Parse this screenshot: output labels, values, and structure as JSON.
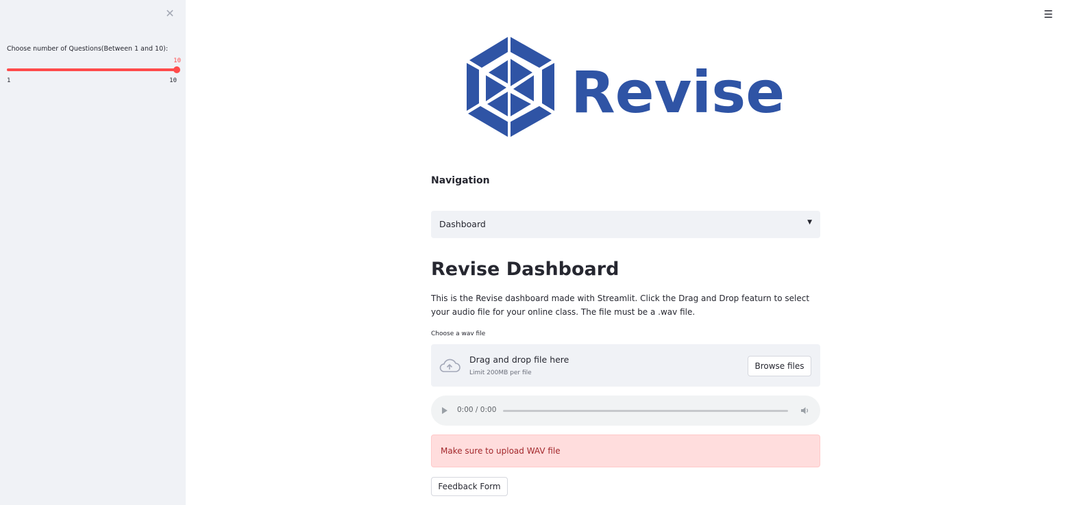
{
  "sidebar": {
    "close_icon": "close-icon",
    "slider": {
      "label": "Choose number of Questions(Between 1 and 10):",
      "value": 10,
      "value_text": "10",
      "min": 1,
      "max": 10,
      "min_text": "1",
      "max_text": "10",
      "accent_color": "#ff4b4b"
    }
  },
  "header": {
    "menu_icon": "hamburger-menu-icon"
  },
  "logo": {
    "text": "Revise",
    "color": "#2f54a5"
  },
  "navigation": {
    "label": "Navigation",
    "selected": "Dashboard"
  },
  "main": {
    "title": "Revise Dashboard",
    "description": "This is the Revise dashboard made with Streamlit. Click the Drag and Drop featurn to select your audio file for your online class. The file must be a .wav file.",
    "uploader": {
      "label": "Choose a wav file",
      "drop_text": "Drag and drop file here",
      "limit_text": "Limit 200MB per file",
      "browse_label": "Browse files"
    },
    "audio": {
      "time": "0:00 / 0:00"
    },
    "alert": {
      "text": "Make sure to upload WAV file",
      "color": "#ffdddd"
    },
    "feedback_label": "Feedback Form"
  }
}
